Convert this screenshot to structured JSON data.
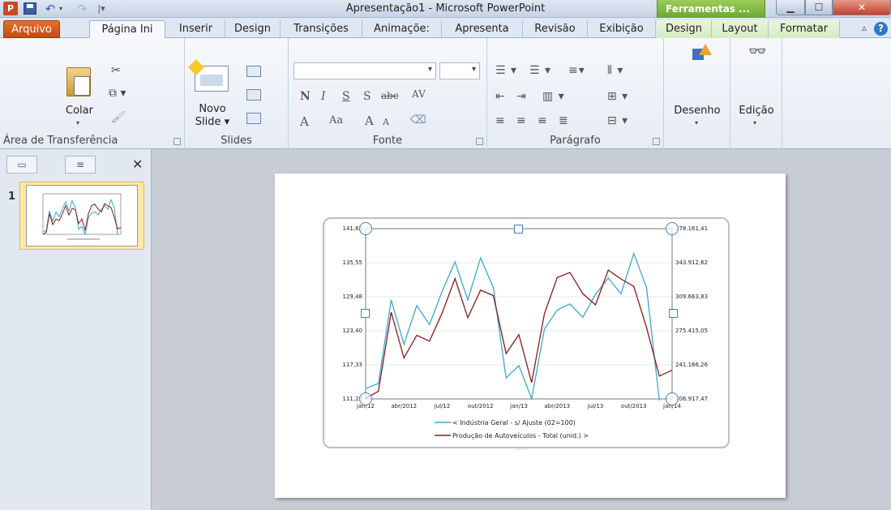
{
  "title_bar": {
    "app_icon": "P",
    "title": "Apresentação1 - Microsoft PowerPoint",
    "context_group": "Ferramentas ...",
    "icons": [
      "powerpoint-icon",
      "save-icon",
      "undo-icon",
      "redo-icon"
    ]
  },
  "tabs": {
    "file": "Arquivo",
    "home": "Página Ini",
    "insert": "Inserir",
    "design": "Design",
    "transitions": "Transições",
    "animations": "Animaçõe:",
    "slideshow": "Apresenta",
    "review": "Revisão",
    "view": "Exibição",
    "ctx_design": "Design",
    "ctx_layout": "Layout",
    "ctx_format": "Formatar"
  },
  "ribbon": {
    "clipboard": {
      "paste": "Colar",
      "label": "Área de Transferência"
    },
    "slides": {
      "new_slide_1": "Novo",
      "new_slide_2": "Slide ▾",
      "label": "Slides"
    },
    "font": {
      "label": "Fonte",
      "bold": "N",
      "italic": "I",
      "underline": "S",
      "shadow": "S",
      "strike": "abc",
      "spacing": "AV",
      "color_a": "A",
      "aa": "Aa",
      "grow": "A",
      "shrink": "A"
    },
    "paragraph": {
      "label": "Parágrafo"
    },
    "drawing": {
      "label": "Desenho"
    },
    "editing": {
      "label": "Edição"
    }
  },
  "slides_pane": {
    "slide_number": "1"
  },
  "chart_data": {
    "type": "line",
    "x_tick_labels": [
      "jan/12",
      "abr/2012",
      "jul/12",
      "out/2012",
      "jan/13",
      "abr/2013",
      "jul/13",
      "out/2013",
      "jan/14"
    ],
    "y_left_ticks": [
      "111,25",
      "117,33",
      "123,40",
      "129,48",
      "135,55",
      "141,62"
    ],
    "y_right_ticks": [
      "206.917,47",
      "241.166,26",
      "275.415,05",
      "309.663,83",
      "343.912,62",
      "378.161,41"
    ],
    "y_left_range": [
      111.25,
      141.62
    ],
    "y_right_range": [
      206917.47,
      378161.41
    ],
    "series": [
      {
        "name": "< Indústria Geral - s/ Ajuste (02=100)",
        "axis": "left",
        "color": "#3aa8d0",
        "values": [
          113.1,
          114.0,
          128.9,
          121.0,
          127.9,
          124.5,
          130.5,
          135.7,
          128.9,
          136.4,
          131.1,
          115.0,
          117.2,
          111.3,
          123.7,
          127.1,
          128.2,
          125.8,
          129.9,
          132.8,
          130.0,
          137.2,
          131.1,
          106.0
        ]
      },
      {
        "name": "Produção de Autoveículos - Total (unid.) >",
        "axis": "right",
        "color": "#8b1a1a",
        "values": [
          207500,
          214600,
          294200,
          248100,
          270900,
          265000,
          293600,
          328000,
          288600,
          316300,
          310900,
          252600,
          271500,
          223300,
          292500,
          328900,
          334100,
          312900,
          301500,
          336500,
          327500,
          320100,
          278600,
          229900,
          235800
        ]
      }
    ],
    "legend_position": "bottom",
    "grid": true
  }
}
